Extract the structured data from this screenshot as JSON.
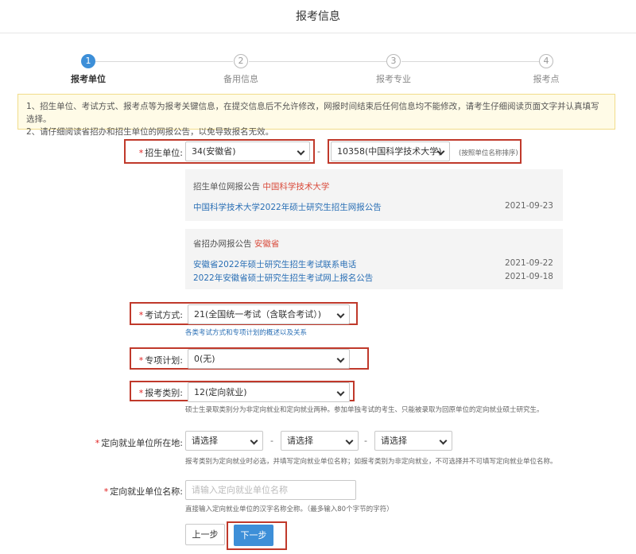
{
  "page_title": "报考信息",
  "steps": [
    {
      "num": "1",
      "label": "报考单位"
    },
    {
      "num": "2",
      "label": "备用信息"
    },
    {
      "num": "3",
      "label": "报考专业"
    },
    {
      "num": "4",
      "label": "报考点"
    }
  ],
  "notice": {
    "line1": "1、招生单位、考试方式、报考点等为报考关键信息，在提交信息后不允许修改，网报时间结束后任何信息均不能修改，请考生仔细阅读页面文字并认真填写选择。",
    "line2": "2、请仔细阅读省招办和招生单位的网报公告，以免导致报名无效。"
  },
  "form": {
    "required_star": "*",
    "unit": {
      "label": "招生单位:",
      "province": "34(安徽省)",
      "dash": "-",
      "school": "10358(中国科学技术大学)",
      "hint": "(按照单位名称排序)"
    },
    "unit_notice": {
      "title": "招生单位网报公告",
      "highlight": "中国科学技术大学",
      "items": [
        {
          "text": "中国科学技术大学2022年硕士研究生招生网报公告",
          "date": "2021-09-23"
        }
      ]
    },
    "province_notice": {
      "title": "省招办网报公告",
      "highlight": "安徽省",
      "items": [
        {
          "text": "安徽省2022年硕士研究生招生考试联系电话",
          "date": "2021-09-22"
        },
        {
          "text": "2022年安徽省硕士研究生招生考试网上报名公告",
          "date": "2021-09-18"
        }
      ]
    },
    "exam_mode": {
      "label": "考试方式:",
      "value": "21(全国统一考试（含联合考试）)",
      "hint": "各类考试方式和专项计划的概述以及关系"
    },
    "special_plan": {
      "label": "专项计划:",
      "value": "0(无)"
    },
    "category": {
      "label": "报考类别:",
      "value": "12(定向就业)",
      "hint": "硕士生录取类别分为非定向就业和定向就业两种。参加单独考试的考生、只能被录取为回原单位的定向就业硕士研究生。"
    },
    "location": {
      "label": "定向就业单位所在地:",
      "sel1": "请选择",
      "sel2": "请选择",
      "sel3": "请选择",
      "dash": "-",
      "hint": "报考类别为定向就业时必选，并填写定向就业单位名称；如报考类别为非定向就业，不可选择并不可填写定向就业单位名称。"
    },
    "employer": {
      "label": "定向就业单位名称:",
      "placeholder": "请输入定向就业单位名称",
      "hint": "直接输入定向就业单位的汉字名称全称。（最多输入80个字节的字符）"
    }
  },
  "buttons": {
    "prev": "上一步",
    "next": "下一步"
  },
  "colors": {
    "accent": "#3d8fd8",
    "annotation": "#c0392b",
    "required": "#e02020"
  }
}
